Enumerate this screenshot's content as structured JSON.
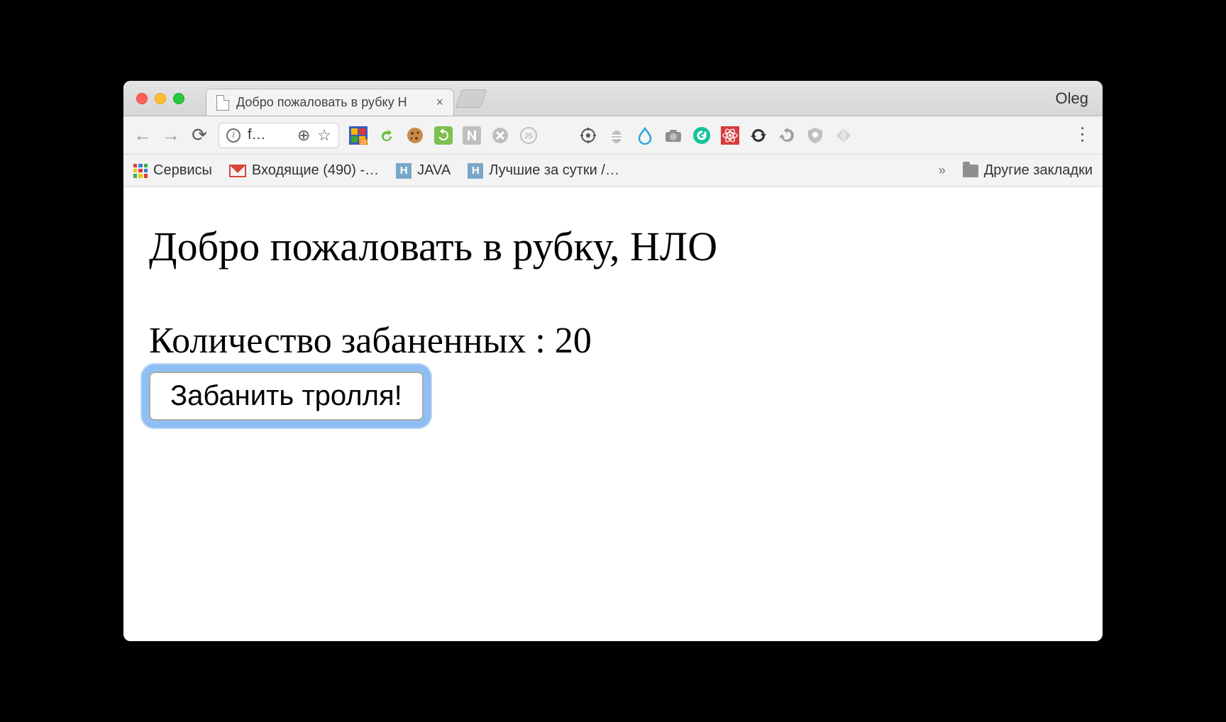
{
  "window": {
    "profile_name": "Oleg"
  },
  "tab": {
    "title": "Добро пожаловать в рубку Н",
    "close_glyph": "×"
  },
  "omnibox": {
    "url_text": "f…",
    "zoom_glyph": "⊕",
    "star_glyph": "☆",
    "info_glyph": "i"
  },
  "nav": {
    "back_glyph": "←",
    "forward_glyph": "→",
    "reload_glyph": "⟳"
  },
  "extensions": {
    "badge_number": "39"
  },
  "bookmarks": {
    "apps_label": "Сервисы",
    "inbox_label": "Входящие (490) -…",
    "java_label": "JAVA",
    "best_label": "Лучшие за сутки /…",
    "overflow_glyph": "»",
    "other_label": "Другие закладки"
  },
  "page": {
    "heading": "Добро пожаловать в рубку, НЛО",
    "subheading": "Количество забаненных : 20",
    "button_label": "Забанить тролля!"
  }
}
